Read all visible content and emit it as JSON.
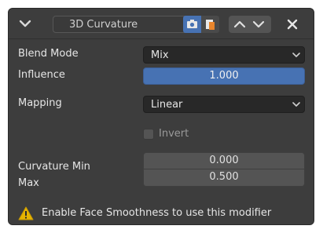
{
  "header": {
    "modifier_name": "3D Curvature"
  },
  "rows": {
    "blend_mode": {
      "label": "Blend Mode",
      "value": "Mix"
    },
    "influence": {
      "label": "Influence",
      "value": "1.000"
    },
    "mapping": {
      "label": "Mapping",
      "value": "Linear"
    },
    "invert": {
      "label": "Invert",
      "checked": false
    },
    "curvature_min": {
      "label": "Curvature Min",
      "value": "0.000"
    },
    "curvature_max": {
      "label": "Max",
      "value": "0.500"
    }
  },
  "warning": {
    "text": "Enable Face Smoothness to use this modifier"
  },
  "colors": {
    "panel_bg": "#3d3d3d",
    "accent_blue": "#4772b3",
    "warning_yellow": "#e6b400"
  },
  "icons": [
    "chevron-down-icon",
    "camera-icon",
    "copy-icon",
    "arrow-up-icon",
    "arrow-down-icon",
    "close-icon",
    "warning-icon"
  ]
}
